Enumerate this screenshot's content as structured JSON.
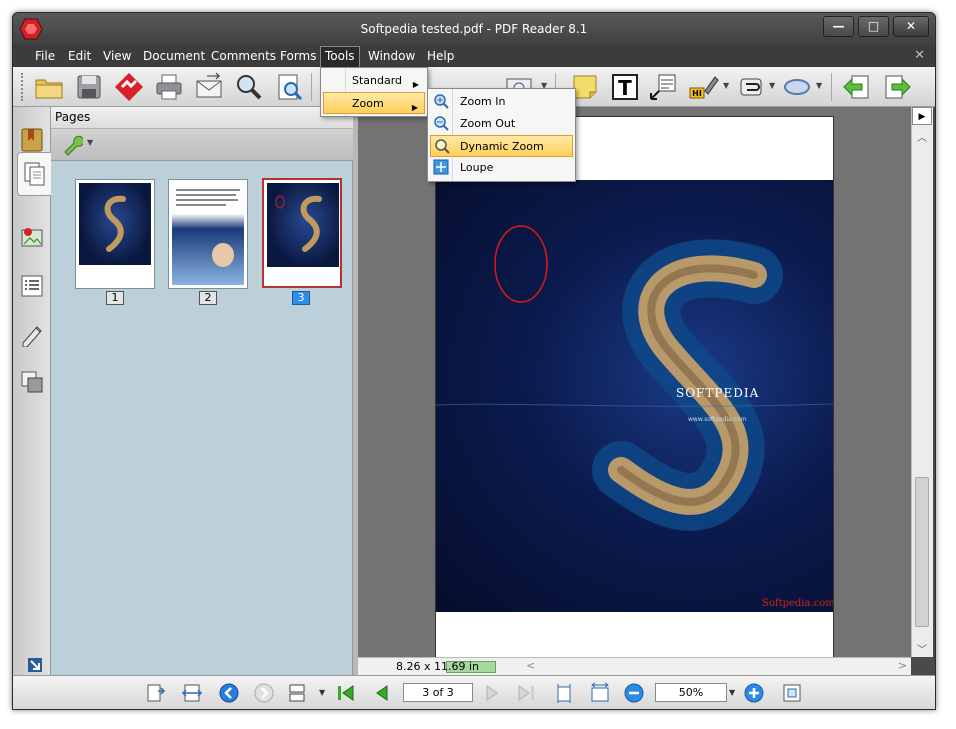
{
  "window": {
    "title": "Softpedia tested.pdf - PDF Reader 8.1",
    "controls": {
      "minimize": "—",
      "maximize": "□",
      "close": "✕"
    }
  },
  "menubar": {
    "items": [
      "File",
      "Edit",
      "View",
      "Document",
      "Comments",
      "Forms",
      "Tools",
      "Window",
      "Help"
    ],
    "active": "Tools",
    "close_doc": "✕"
  },
  "tools_menu": {
    "items": [
      {
        "label": "Standard",
        "has_submenu": true
      },
      {
        "label": "Zoom",
        "has_submenu": true,
        "highlighted": true
      }
    ],
    "watermark": "SOFTPEDIA"
  },
  "zoom_submenu": {
    "items": [
      {
        "label": "Zoom In",
        "icon": "zoom-in-icon"
      },
      {
        "label": "Zoom Out",
        "icon": "zoom-out-icon"
      },
      {
        "label": "Dynamic Zoom",
        "icon": "dynamic-zoom-icon",
        "highlighted": true
      },
      {
        "label": "Loupe",
        "icon": "loupe-icon"
      }
    ]
  },
  "pages_panel": {
    "title": "Pages",
    "thumbnails": [
      {
        "number": "1",
        "selected": false
      },
      {
        "number": "2",
        "selected": false
      },
      {
        "number": "3",
        "selected": true
      }
    ]
  },
  "document": {
    "page_size": "8.26 x 11.69 in",
    "image_caption": "SOFTPEDIA",
    "image_url_text": "www.softpedia.com",
    "image_signature": "Softpedia.com"
  },
  "navbar": {
    "page_indicator": "3 of 3",
    "zoom_value": "50%"
  },
  "colors": {
    "titlebar": "#3f3f3f",
    "highlight": "#ffcf5a",
    "selection_blue": "#2e8fe8",
    "doc_background": "#737373"
  }
}
